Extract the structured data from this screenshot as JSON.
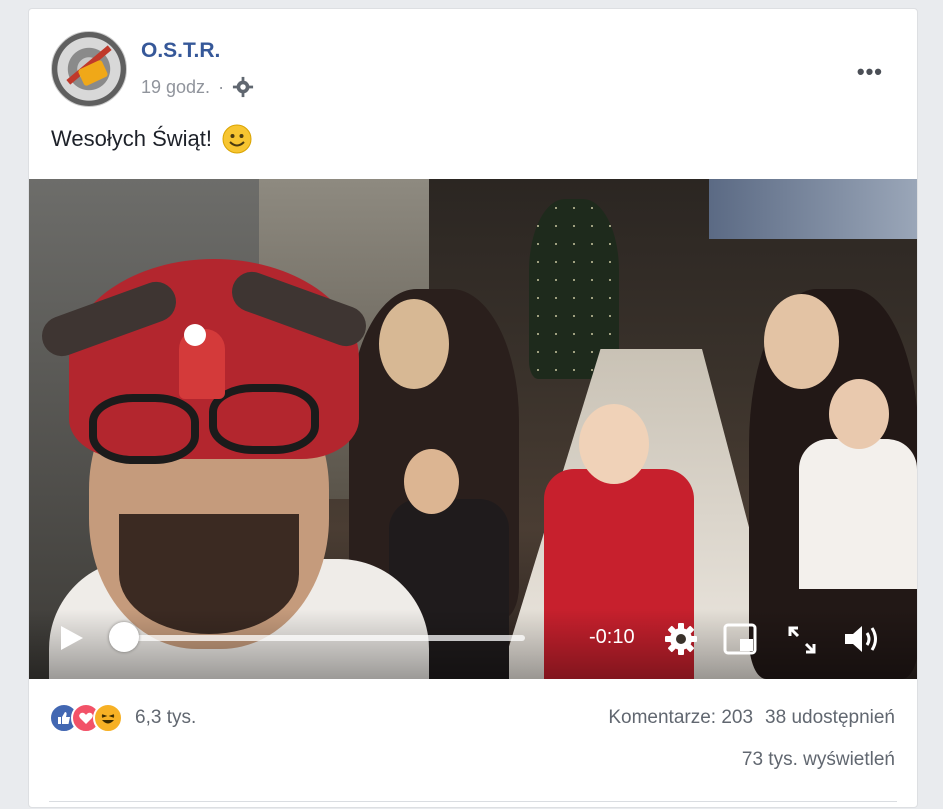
{
  "post": {
    "page_name": "O.S.T.R.",
    "time": "19 godz.",
    "separator": "·",
    "text": "Wesołych Świąt!",
    "menu_glyph": "•••"
  },
  "video": {
    "time_remaining": "-0:10",
    "progress": 0.0,
    "icons": [
      "play-icon",
      "settings-icon",
      "pip-icon",
      "fullscreen-icon",
      "volume-icon"
    ]
  },
  "footer": {
    "reactions": [
      "like",
      "love",
      "haha"
    ],
    "reaction_count": "6,3 tys.",
    "comments": "Komentarze: 203",
    "shares": "38 udostępnień",
    "views": "73 tys. wyświetleń"
  },
  "colors": {
    "link_blue": "#365899",
    "meta_gray": "#90949c",
    "like_blue": "#4267b2",
    "love_red": "#f25268",
    "haha_yellow": "#f7b125"
  }
}
